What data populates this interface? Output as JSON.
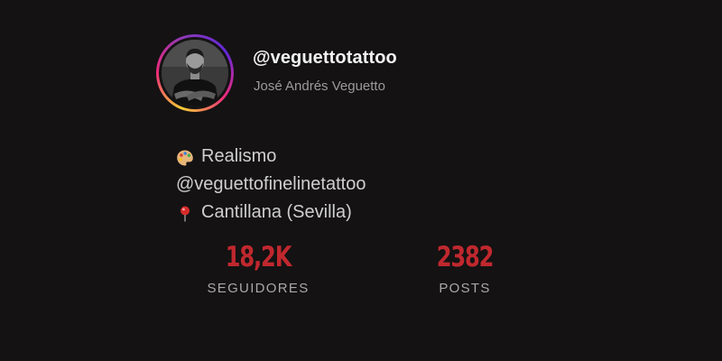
{
  "profile": {
    "username": "@veguettotattoo",
    "full_name": "José Andrés Veguetto",
    "avatar_ring_colors": [
      "#f9ce34",
      "#ee2a7b",
      "#8a3ab9",
      "#6228d7"
    ]
  },
  "bio": [
    {
      "icon": "palette-icon",
      "text": "Realismo"
    },
    {
      "icon": null,
      "text": "@veguettofinelinetattoo"
    },
    {
      "icon": "round-pushpin-icon",
      "text": "Cantillana (Sevilla)"
    }
  ],
  "stats": [
    {
      "value": "18,2K",
      "label": "SEGUIDORES"
    },
    {
      "value": "2382",
      "label": "POSTS"
    }
  ],
  "colors": {
    "background": "#141213",
    "stat_value": "#c0282e",
    "username": "#f2f2f2",
    "secondary_text": "#9b9b9b"
  }
}
